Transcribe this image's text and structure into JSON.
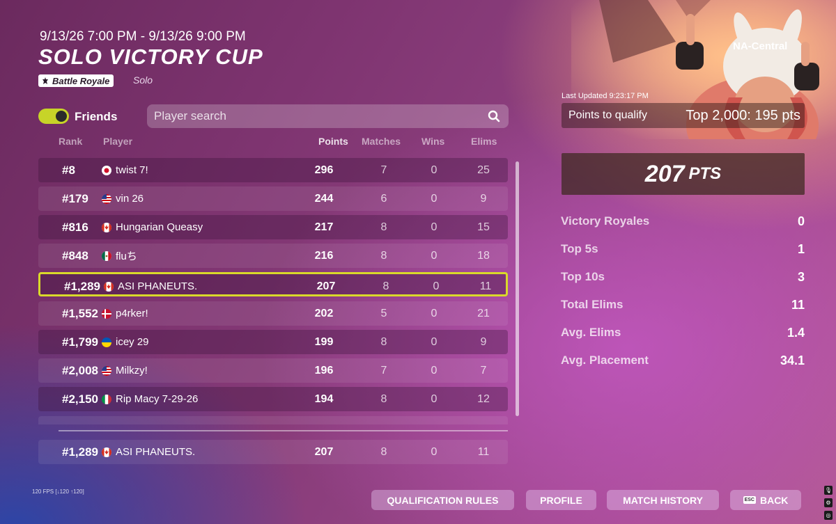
{
  "event": {
    "date_range": "9/13/26 7:00 PM - 9/13/26 9:00 PM",
    "title": "SOLO VICTORY CUP",
    "mode": "Battle Royale",
    "mode_sub": "Solo"
  },
  "friends": {
    "label": "Friends",
    "enabled": true
  },
  "search": {
    "placeholder": "Player search"
  },
  "columns": {
    "rank": "Rank",
    "player": "Player",
    "points": "Points",
    "matches": "Matches",
    "wins": "Wins",
    "elims": "Elims"
  },
  "rows": [
    {
      "rank": "#8",
      "name": "twist 7!",
      "flag": "japan",
      "points": "296",
      "matches": "7",
      "wins": "0",
      "elims": "25"
    },
    {
      "rank": "#179",
      "name": "vin 26",
      "flag": "usa",
      "points": "244",
      "matches": "6",
      "wins": "0",
      "elims": "9"
    },
    {
      "rank": "#816",
      "name": "Hungarian Queasy",
      "flag": "canada",
      "points": "217",
      "matches": "8",
      "wins": "0",
      "elims": "15"
    },
    {
      "rank": "#848",
      "name": "fluち",
      "flag": "mexico",
      "points": "216",
      "matches": "8",
      "wins": "0",
      "elims": "18"
    },
    {
      "rank": "#1,289",
      "name": "ASI PHANEUTS.",
      "flag": "canada",
      "points": "207",
      "matches": "8",
      "wins": "0",
      "elims": "11"
    },
    {
      "rank": "#1,552",
      "name": "p4rker!",
      "flag": "denmark",
      "points": "202",
      "matches": "5",
      "wins": "0",
      "elims": "21"
    },
    {
      "rank": "#1,799",
      "name": "icey 29",
      "flag": "ukraine",
      "points": "199",
      "matches": "8",
      "wins": "0",
      "elims": "9"
    },
    {
      "rank": "#2,008",
      "name": "Milkzy!",
      "flag": "usa",
      "points": "196",
      "matches": "7",
      "wins": "0",
      "elims": "7"
    },
    {
      "rank": "#2,150",
      "name": "Rip Macy 7-29-26",
      "flag": "italy",
      "points": "194",
      "matches": "8",
      "wins": "0",
      "elims": "12"
    }
  ],
  "self_row": {
    "rank": "#1,289",
    "name": "ASI PHANEUTS.",
    "flag": "canada",
    "points": "207",
    "matches": "8",
    "wins": "0",
    "elims": "11"
  },
  "panel": {
    "region": "NA-Central",
    "last_updated": "Last Updated 9:23:17 PM",
    "qualify_label": "Points to qualify",
    "qualify_value": "Top 2,000: 195 pts",
    "points_value": "207",
    "points_unit": "PTS",
    "stats": [
      {
        "label": "Victory Royales",
        "value": "0"
      },
      {
        "label": "Top 5s",
        "value": "1"
      },
      {
        "label": "Top 10s",
        "value": "3"
      },
      {
        "label": "Total Elims",
        "value": "11"
      },
      {
        "label": "Avg. Elims",
        "value": "1.4"
      },
      {
        "label": "Avg. Placement",
        "value": "34.1"
      }
    ]
  },
  "fps": "120 FPS [↓120 ↑120]",
  "buttons": {
    "qualification_rules": "QUALIFICATION RULES",
    "profile": "PROFILE",
    "match_history": "MATCH HISTORY",
    "back": "BACK",
    "esc": "ESC"
  },
  "colors": {
    "highlight": "#d9d92a",
    "toggle_on": "#c7d428"
  }
}
